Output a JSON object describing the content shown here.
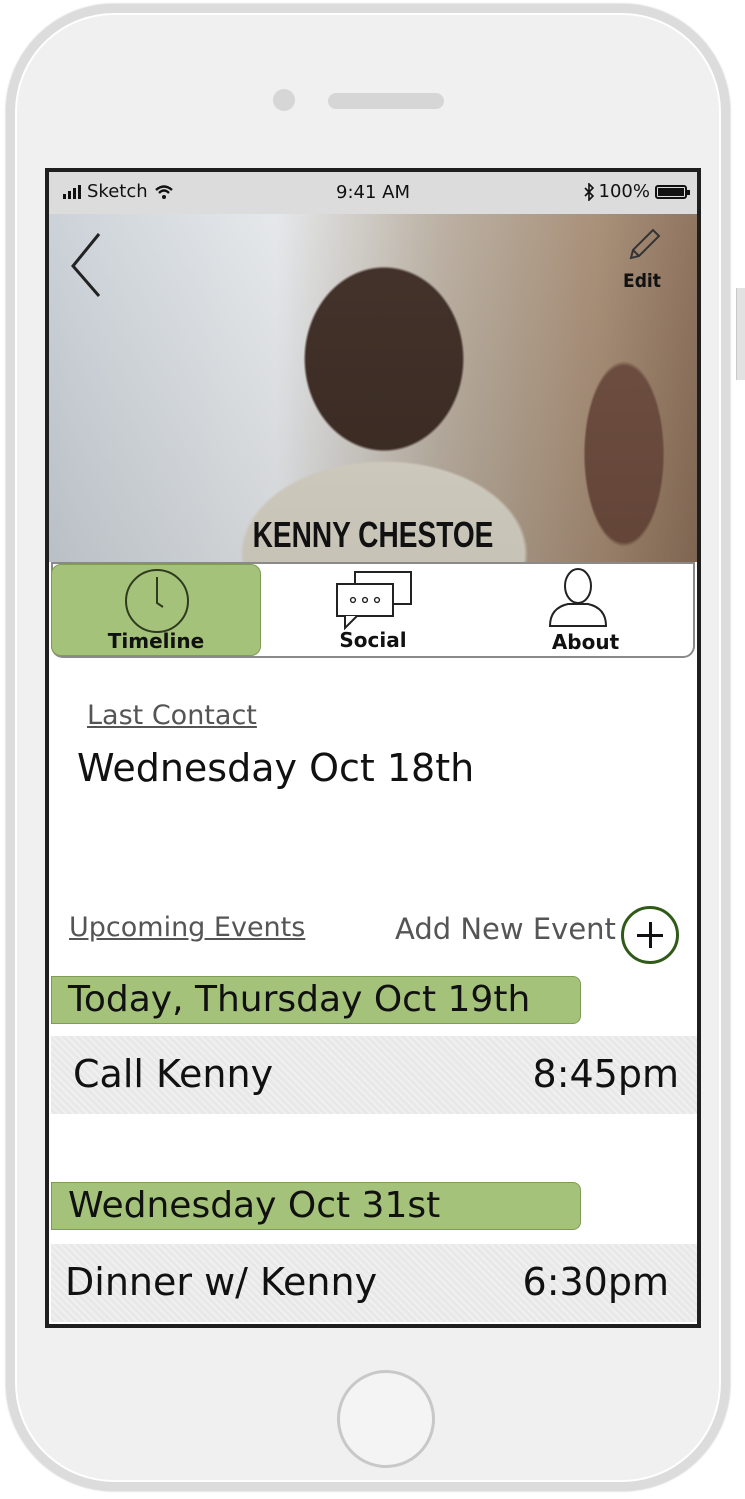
{
  "status_bar": {
    "carrier": "Sketch",
    "time": "9:41 AM",
    "battery": "100%"
  },
  "header": {
    "name": "KENNY CHESTOE",
    "edit_label": "Edit"
  },
  "tabs": [
    {
      "label": "Timeline",
      "active": true
    },
    {
      "label": "Social",
      "active": false
    },
    {
      "label": "About",
      "active": false
    }
  ],
  "last_contact": {
    "label": "Last Contact",
    "date": "Wednesday Oct 18th"
  },
  "upcoming": {
    "label": "Upcoming Events",
    "add_label": "Add New Event"
  },
  "events": [
    {
      "day": "Today, Thursday Oct 19th",
      "title": "Call Kenny",
      "time": "8:45pm"
    },
    {
      "day": "Wednesday Oct 31st",
      "title": "Dinner w/ Kenny",
      "time": "6:30pm"
    }
  ],
  "colors": {
    "accent_green": "#a5c27a",
    "add_button_ring": "#2f5a17"
  }
}
